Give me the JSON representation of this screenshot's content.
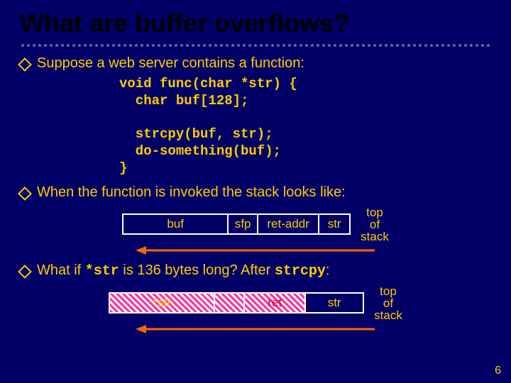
{
  "title": "What are buffer overflows?",
  "bullets": {
    "b1": "Suppose a web server contains a function:",
    "b2": "When the function is invoked the stack looks like:",
    "b3_pre": "What if ",
    "b3_code1": "*str",
    "b3_mid": " is 136 bytes long?  After ",
    "b3_code2": "strcpy",
    "b3_post": ":"
  },
  "code_lines": {
    "l1": "void func(char *str) {",
    "l2": "  char buf[128];",
    "l3": "",
    "l4": "  strcpy(buf, str);",
    "l5": "  do-something(buf);",
    "l6": "}"
  },
  "diagram1": {
    "buf": "buf",
    "sfp": "sfp",
    "ret": "ret-addr",
    "str": "str"
  },
  "tos": {
    "top": "top",
    "of": "of",
    "stack": "stack"
  },
  "diagram2": {
    "star_str": "*str",
    "ret": "ret",
    "str": "str"
  },
  "slide_number": "6"
}
